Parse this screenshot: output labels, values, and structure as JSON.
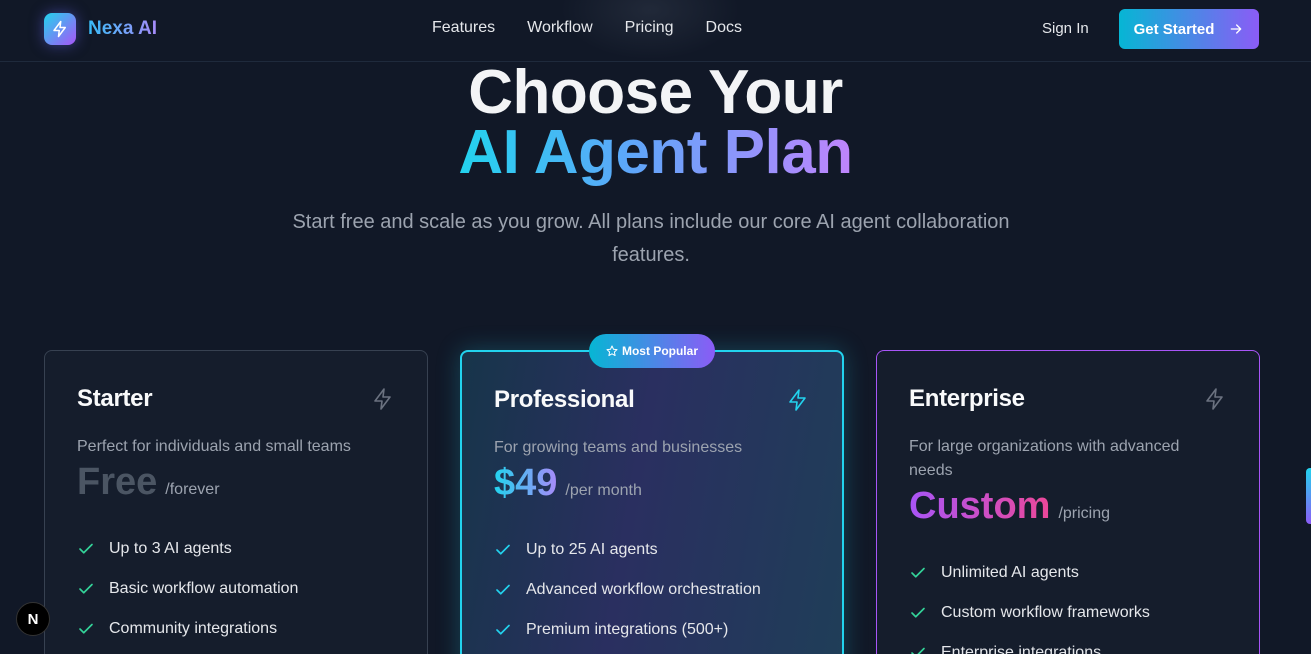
{
  "brand": {
    "name": "Nexa AI",
    "logo_icon": "lightning-icon"
  },
  "nav": {
    "links": [
      {
        "label": "Features"
      },
      {
        "label": "Workflow"
      },
      {
        "label": "Pricing"
      },
      {
        "label": "Docs"
      }
    ],
    "sign_in": "Sign In",
    "cta": {
      "label": "Get Started",
      "icon": "arrow-right-icon"
    }
  },
  "hero": {
    "title_line1": "Choose Your",
    "title_line2": "AI Agent Plan",
    "subtitle": "Start free and scale as you grow. All plans include our core AI agent collaboration features."
  },
  "plans": [
    {
      "name": "Starter",
      "icon": "lightning-icon",
      "description": "Perfect for individuals and small teams",
      "price": "Free",
      "period": "/forever",
      "features": [
        "Up to 3 AI agents",
        "Basic workflow automation",
        "Community integrations"
      ]
    },
    {
      "name": "Professional",
      "icon": "lightning-icon",
      "badge": "Most Popular",
      "description": "For growing teams and businesses",
      "price": "$49",
      "period": "/per month",
      "features": [
        "Up to 25 AI agents",
        "Advanced workflow orchestration",
        "Premium integrations (500+)"
      ]
    },
    {
      "name": "Enterprise",
      "icon": "lightning-icon",
      "description": "For large organizations with advanced needs",
      "price": "Custom",
      "period": "/pricing",
      "features": [
        "Unlimited AI agents",
        "Custom workflow frameworks",
        "Enterprise integrations"
      ]
    }
  ],
  "dev_indicator": {
    "label": "N"
  },
  "colors": {
    "accent_cyan": "#22d3ee",
    "accent_purple": "#a855f7",
    "background": "#111827",
    "check_green": "#34d399"
  }
}
